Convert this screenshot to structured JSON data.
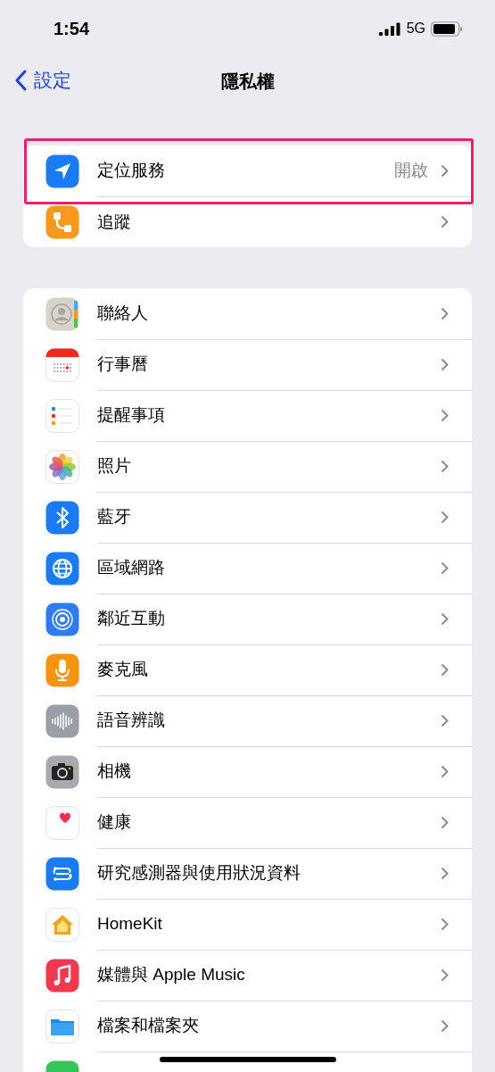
{
  "status_bar": {
    "time": "1:54",
    "network": "5G"
  },
  "nav": {
    "back": "設定",
    "title": "隱私權"
  },
  "groups": [
    {
      "items": [
        {
          "kind": "setting",
          "label": "定位服務",
          "value": "開啟",
          "highlighted": true
        },
        {
          "kind": "setting",
          "label": "追蹤",
          "highlighted": false
        }
      ]
    },
    {
      "items": [
        {
          "kind": "setting",
          "label": "聯絡人"
        },
        {
          "kind": "setting",
          "label": "行事曆"
        },
        {
          "kind": "setting",
          "label": "提醒事項"
        },
        {
          "kind": "setting",
          "label": "照片"
        },
        {
          "kind": "setting",
          "label": "藍牙"
        },
        {
          "kind": "setting",
          "label": "區域網路"
        },
        {
          "kind": "setting",
          "label": "鄰近互動"
        },
        {
          "kind": "setting",
          "label": "麥克風"
        },
        {
          "kind": "setting",
          "label": "語音辨識"
        },
        {
          "kind": "setting",
          "label": "相機"
        },
        {
          "kind": "setting",
          "label": "健康"
        },
        {
          "kind": "setting",
          "label": "研究感測器與使用狀況資料"
        },
        {
          "kind": "setting",
          "label": "HomeKit"
        },
        {
          "kind": "setting",
          "label": "媒體與 Apple Music"
        },
        {
          "kind": "setting",
          "label": "檔案和檔案夾"
        },
        {
          "kind": "partial"
        }
      ]
    }
  ]
}
